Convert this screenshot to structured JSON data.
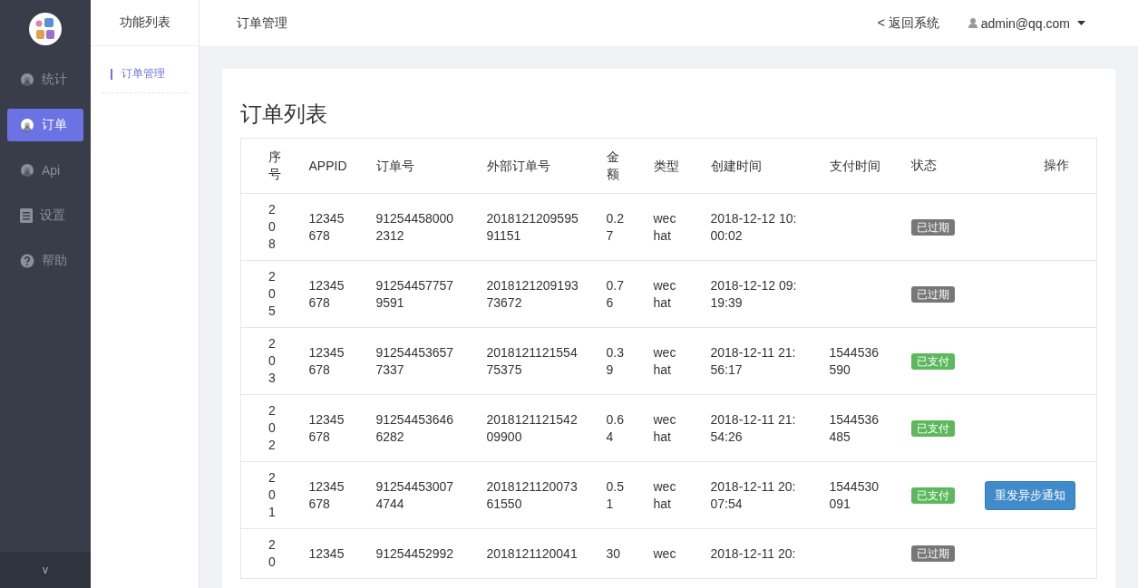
{
  "sidebar": {
    "items": [
      {
        "label": "统计",
        "kind": "chart",
        "selected": false
      },
      {
        "label": "订单",
        "kind": "chart",
        "selected": true
      },
      {
        "label": "Api",
        "kind": "chart",
        "selected": false
      },
      {
        "label": "设置",
        "kind": "document",
        "selected": false
      },
      {
        "label": "帮助",
        "kind": "help",
        "selected": false
      }
    ],
    "collapse": "v"
  },
  "submenu": {
    "title": "功能列表",
    "items": [
      {
        "label": "订单管理",
        "selected": true
      }
    ]
  },
  "topbar": {
    "title": "订单管理",
    "back": "< 返回系统",
    "user": "admin@qq.com"
  },
  "card": {
    "title": "订单列表"
  },
  "table": {
    "columns": [
      "序号",
      "APPID",
      "订单号",
      "外部订单号",
      "金额",
      "类型",
      "创建时间",
      "支付时间",
      "状态",
      "操作"
    ],
    "rows": [
      {
        "seq": "208",
        "appid": "12345678",
        "order_no": "912544580002312",
        "external_no": "201812120959591151",
        "amount": "0.27",
        "type": "wechat",
        "created": "2018-12-12 10:00:02",
        "paid": "",
        "status": {
          "label": "已过期",
          "kind": "expired"
        }
      },
      {
        "seq": "205",
        "appid": "12345678",
        "order_no": "912544577579591",
        "external_no": "201812120919373672",
        "amount": "0.76",
        "type": "wechat",
        "created": "2018-12-12 09:19:39",
        "paid": "",
        "status": {
          "label": "已过期",
          "kind": "expired"
        }
      },
      {
        "seq": "203",
        "appid": "12345678",
        "order_no": "912544536577337",
        "external_no": "201812112155475375",
        "amount": "0.39",
        "type": "wechat",
        "created": "2018-12-11 21:56:17",
        "paid": "1544536590",
        "status": {
          "label": "已支付",
          "kind": "paid"
        }
      },
      {
        "seq": "202",
        "appid": "12345678",
        "order_no": "912544536466282",
        "external_no": "201812112154209900",
        "amount": "0.64",
        "type": "wechat",
        "created": "2018-12-11 21:54:26",
        "paid": "1544536485",
        "status": {
          "label": "已支付",
          "kind": "paid"
        }
      },
      {
        "seq": "201",
        "appid": "12345678",
        "order_no": "912544530074744",
        "external_no": "201812112007361550",
        "amount": "0.51",
        "type": "wechat",
        "created": "2018-12-11 20:07:54",
        "paid": "1544530091",
        "status": {
          "label": "已支付",
          "kind": "paid"
        },
        "action": "重发异步通知"
      },
      {
        "seq": "20",
        "appid": "12345",
        "order_no": "91254452992",
        "external_no": "2018121120041",
        "amount": "30",
        "type": "wec",
        "created": "2018-12-11 20:",
        "paid": "",
        "status": {
          "label": "已过期",
          "kind": "expired"
        }
      }
    ]
  }
}
